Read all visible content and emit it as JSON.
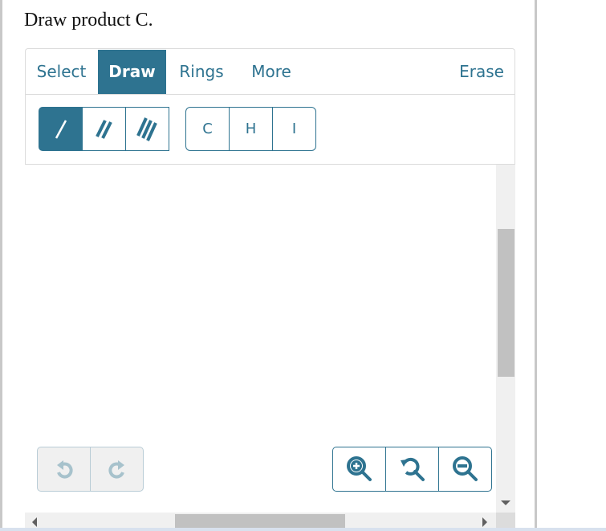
{
  "prompt": "Draw product C.",
  "toolbar": {
    "tabs": [
      {
        "label": "Select",
        "active": false
      },
      {
        "label": "Draw",
        "active": true
      },
      {
        "label": "Rings",
        "active": false
      },
      {
        "label": "More",
        "active": false
      }
    ],
    "erase_label": "Erase"
  },
  "bonds": [
    {
      "icon": "single-bond-icon",
      "active": true
    },
    {
      "icon": "double-bond-icon",
      "active": false
    },
    {
      "icon": "triple-bond-icon",
      "active": false
    }
  ],
  "atoms": [
    "C",
    "H",
    "I"
  ],
  "history": [
    {
      "icon": "undo-icon",
      "enabled": false
    },
    {
      "icon": "redo-icon",
      "enabled": false
    }
  ],
  "zoom_controls": [
    {
      "icon": "zoom-in-icon"
    },
    {
      "icon": "zoom-reset-icon"
    },
    {
      "icon": "zoom-out-icon"
    }
  ],
  "colors": {
    "accent": "#2e7390",
    "disabled_icon": "#a7c2cc"
  }
}
